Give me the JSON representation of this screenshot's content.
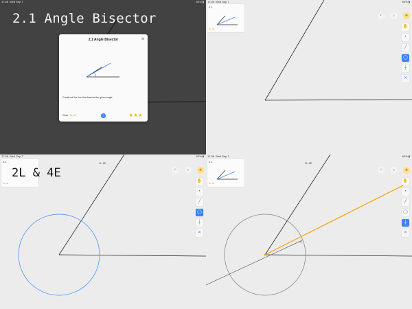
{
  "status": {
    "time": "17:06",
    "date": "Wed Sep 7",
    "battery": "60%"
  },
  "panel1": {
    "overlay_title": "2.1 Angle Bisector",
    "modal": {
      "title": "2.1 Angle Bisector",
      "close_icon": "close-icon",
      "description": "Construct the line that bisects the given angle.",
      "goal_label": "Goal:",
      "goal_value": "3L 4E",
      "help_glyph": "?",
      "stars": "★★★"
    }
  },
  "panel2": {
    "level_name": "2.1",
    "goal": "3L 4E"
  },
  "panel3": {
    "level_name": "2.1",
    "goal": "2L 4E",
    "caption": "2L & 4E",
    "counter": "1L 1E"
  },
  "panel4": {
    "level_name": "2.1",
    "goal": "3L 4E",
    "counter": "2L 4E"
  },
  "toolbar": {
    "tools": [
      {
        "name": "move-tool",
        "glyph": "✋",
        "icon": "hand-icon"
      },
      {
        "name": "point-tool",
        "glyph": "•",
        "icon": "point-icon"
      },
      {
        "name": "line-tool",
        "glyph": "╱",
        "icon": "line-icon"
      },
      {
        "name": "circle-tool",
        "glyph": "◯",
        "icon": "circle-icon"
      },
      {
        "name": "perpendicular-tool",
        "glyph": "┼",
        "icon": "perpendicular-icon"
      },
      {
        "name": "intersect-tool",
        "glyph": "✕",
        "icon": "intersect-icon"
      }
    ]
  },
  "colors": {
    "accent": "#3b82f6",
    "construction": "#f0a500",
    "line": "#222222",
    "gold": "#e6b400"
  }
}
